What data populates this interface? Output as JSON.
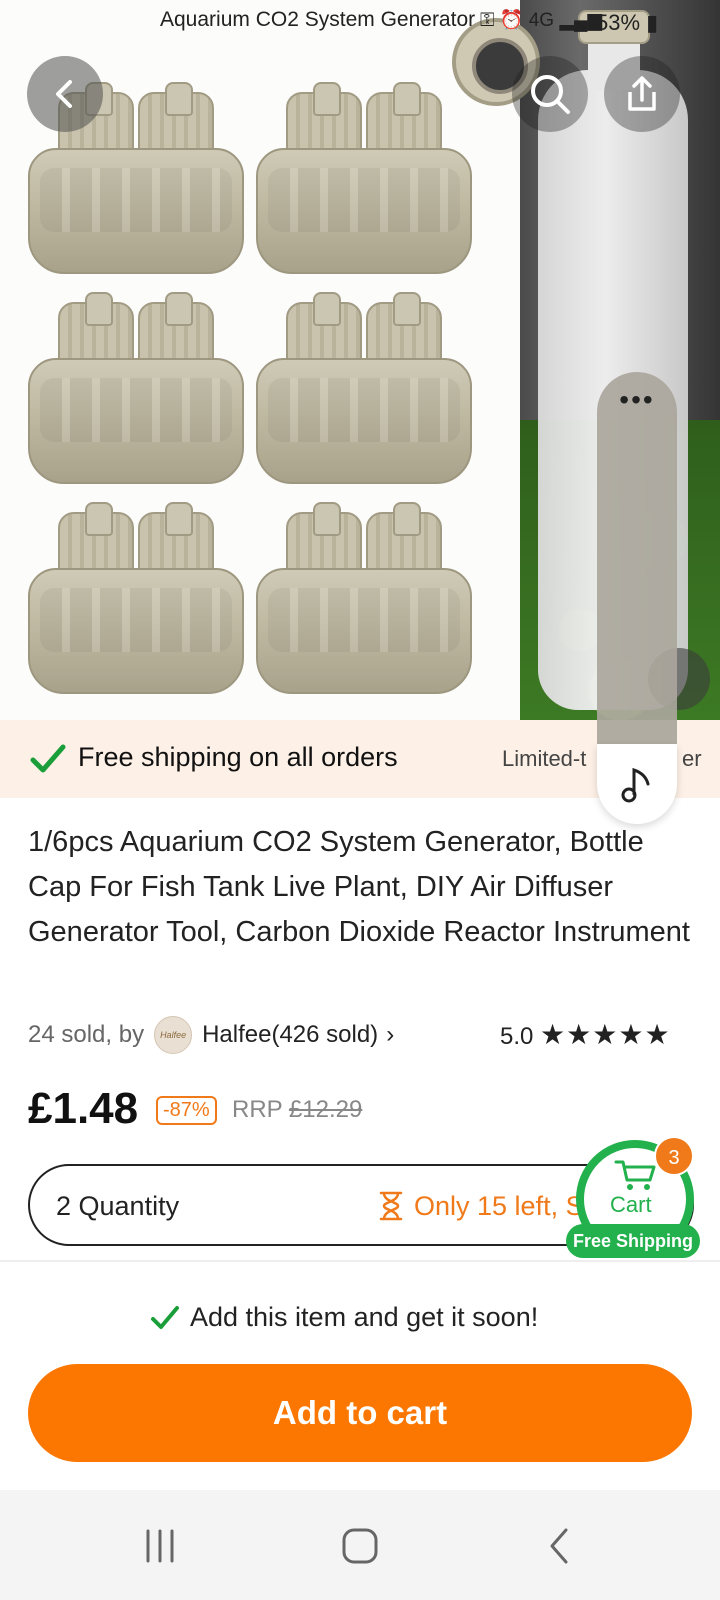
{
  "status_bar": {
    "title": "Aquarium CO2 System Generator",
    "network": "4G",
    "battery": "53%"
  },
  "product": {
    "title": "1/6pcs Aquarium CO2 System Generator, Bottle Cap For Fish Tank Live Plant, DIY Air Diffuser Generator Tool, Carbon Dioxide Reactor Instrument",
    "sold": "24 sold, by",
    "seller": "Halfee(426 sold)",
    "seller_avatar_text": "Halfee",
    "rating": "5.0",
    "stars": "★★★★★",
    "price": "£1.48",
    "discount": "-87%",
    "rrp_label": "RRP",
    "rrp_value": "£12.29"
  },
  "shipping_banner": {
    "text": "Free shipping on all orders",
    "limited_start": "Limited-t",
    "limited_end": "er"
  },
  "quantity": {
    "label": "2 Quantity",
    "stock": "Only 15 left, S"
  },
  "cart": {
    "label": "Cart",
    "count": "3",
    "free_shipping": "Free Shipping"
  },
  "actions": {
    "soon_text": "Add this item and get it soon!",
    "add_to_cart": "Add to cart"
  },
  "side_panel": {
    "dots": "•••"
  },
  "colors": {
    "accent": "#fb7701",
    "green": "#22b14c",
    "banner_bg": "#fdf0e6"
  }
}
